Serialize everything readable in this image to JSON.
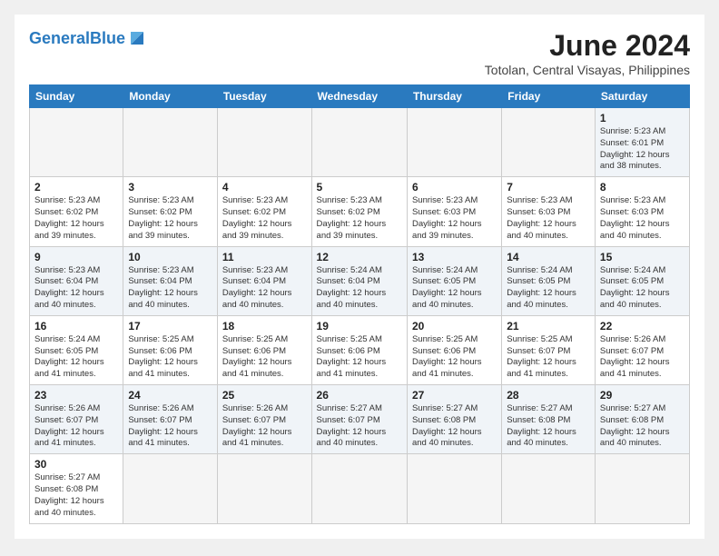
{
  "header": {
    "logo_general": "General",
    "logo_blue": "Blue",
    "month_title": "June 2024",
    "subtitle": "Totolan, Central Visayas, Philippines"
  },
  "weekdays": [
    "Sunday",
    "Monday",
    "Tuesday",
    "Wednesday",
    "Thursday",
    "Friday",
    "Saturday"
  ],
  "weeks": [
    [
      {
        "day": "",
        "info": ""
      },
      {
        "day": "",
        "info": ""
      },
      {
        "day": "",
        "info": ""
      },
      {
        "day": "",
        "info": ""
      },
      {
        "day": "",
        "info": ""
      },
      {
        "day": "",
        "info": ""
      },
      {
        "day": "1",
        "info": "Sunrise: 5:23 AM\nSunset: 6:01 PM\nDaylight: 12 hours\nand 38 minutes."
      }
    ],
    [
      {
        "day": "2",
        "info": "Sunrise: 5:23 AM\nSunset: 6:02 PM\nDaylight: 12 hours\nand 39 minutes."
      },
      {
        "day": "3",
        "info": "Sunrise: 5:23 AM\nSunset: 6:02 PM\nDaylight: 12 hours\nand 39 minutes."
      },
      {
        "day": "4",
        "info": "Sunrise: 5:23 AM\nSunset: 6:02 PM\nDaylight: 12 hours\nand 39 minutes."
      },
      {
        "day": "5",
        "info": "Sunrise: 5:23 AM\nSunset: 6:02 PM\nDaylight: 12 hours\nand 39 minutes."
      },
      {
        "day": "6",
        "info": "Sunrise: 5:23 AM\nSunset: 6:03 PM\nDaylight: 12 hours\nand 39 minutes."
      },
      {
        "day": "7",
        "info": "Sunrise: 5:23 AM\nSunset: 6:03 PM\nDaylight: 12 hours\nand 40 minutes."
      },
      {
        "day": "8",
        "info": "Sunrise: 5:23 AM\nSunset: 6:03 PM\nDaylight: 12 hours\nand 40 minutes."
      }
    ],
    [
      {
        "day": "9",
        "info": "Sunrise: 5:23 AM\nSunset: 6:04 PM\nDaylight: 12 hours\nand 40 minutes."
      },
      {
        "day": "10",
        "info": "Sunrise: 5:23 AM\nSunset: 6:04 PM\nDaylight: 12 hours\nand 40 minutes."
      },
      {
        "day": "11",
        "info": "Sunrise: 5:23 AM\nSunset: 6:04 PM\nDaylight: 12 hours\nand 40 minutes."
      },
      {
        "day": "12",
        "info": "Sunrise: 5:24 AM\nSunset: 6:04 PM\nDaylight: 12 hours\nand 40 minutes."
      },
      {
        "day": "13",
        "info": "Sunrise: 5:24 AM\nSunset: 6:05 PM\nDaylight: 12 hours\nand 40 minutes."
      },
      {
        "day": "14",
        "info": "Sunrise: 5:24 AM\nSunset: 6:05 PM\nDaylight: 12 hours\nand 40 minutes."
      },
      {
        "day": "15",
        "info": "Sunrise: 5:24 AM\nSunset: 6:05 PM\nDaylight: 12 hours\nand 40 minutes."
      }
    ],
    [
      {
        "day": "16",
        "info": "Sunrise: 5:24 AM\nSunset: 6:05 PM\nDaylight: 12 hours\nand 41 minutes."
      },
      {
        "day": "17",
        "info": "Sunrise: 5:25 AM\nSunset: 6:06 PM\nDaylight: 12 hours\nand 41 minutes."
      },
      {
        "day": "18",
        "info": "Sunrise: 5:25 AM\nSunset: 6:06 PM\nDaylight: 12 hours\nand 41 minutes."
      },
      {
        "day": "19",
        "info": "Sunrise: 5:25 AM\nSunset: 6:06 PM\nDaylight: 12 hours\nand 41 minutes."
      },
      {
        "day": "20",
        "info": "Sunrise: 5:25 AM\nSunset: 6:06 PM\nDaylight: 12 hours\nand 41 minutes."
      },
      {
        "day": "21",
        "info": "Sunrise: 5:25 AM\nSunset: 6:07 PM\nDaylight: 12 hours\nand 41 minutes."
      },
      {
        "day": "22",
        "info": "Sunrise: 5:26 AM\nSunset: 6:07 PM\nDaylight: 12 hours\nand 41 minutes."
      }
    ],
    [
      {
        "day": "23",
        "info": "Sunrise: 5:26 AM\nSunset: 6:07 PM\nDaylight: 12 hours\nand 41 minutes."
      },
      {
        "day": "24",
        "info": "Sunrise: 5:26 AM\nSunset: 6:07 PM\nDaylight: 12 hours\nand 41 minutes."
      },
      {
        "day": "25",
        "info": "Sunrise: 5:26 AM\nSunset: 6:07 PM\nDaylight: 12 hours\nand 41 minutes."
      },
      {
        "day": "26",
        "info": "Sunrise: 5:27 AM\nSunset: 6:07 PM\nDaylight: 12 hours\nand 40 minutes."
      },
      {
        "day": "27",
        "info": "Sunrise: 5:27 AM\nSunset: 6:08 PM\nDaylight: 12 hours\nand 40 minutes."
      },
      {
        "day": "28",
        "info": "Sunrise: 5:27 AM\nSunset: 6:08 PM\nDaylight: 12 hours\nand 40 minutes."
      },
      {
        "day": "29",
        "info": "Sunrise: 5:27 AM\nSunset: 6:08 PM\nDaylight: 12 hours\nand 40 minutes."
      }
    ],
    [
      {
        "day": "30",
        "info": "Sunrise: 5:27 AM\nSunset: 6:08 PM\nDaylight: 12 hours\nand 40 minutes."
      },
      {
        "day": "",
        "info": ""
      },
      {
        "day": "",
        "info": ""
      },
      {
        "day": "",
        "info": ""
      },
      {
        "day": "",
        "info": ""
      },
      {
        "day": "",
        "info": ""
      },
      {
        "day": "",
        "info": ""
      }
    ]
  ]
}
